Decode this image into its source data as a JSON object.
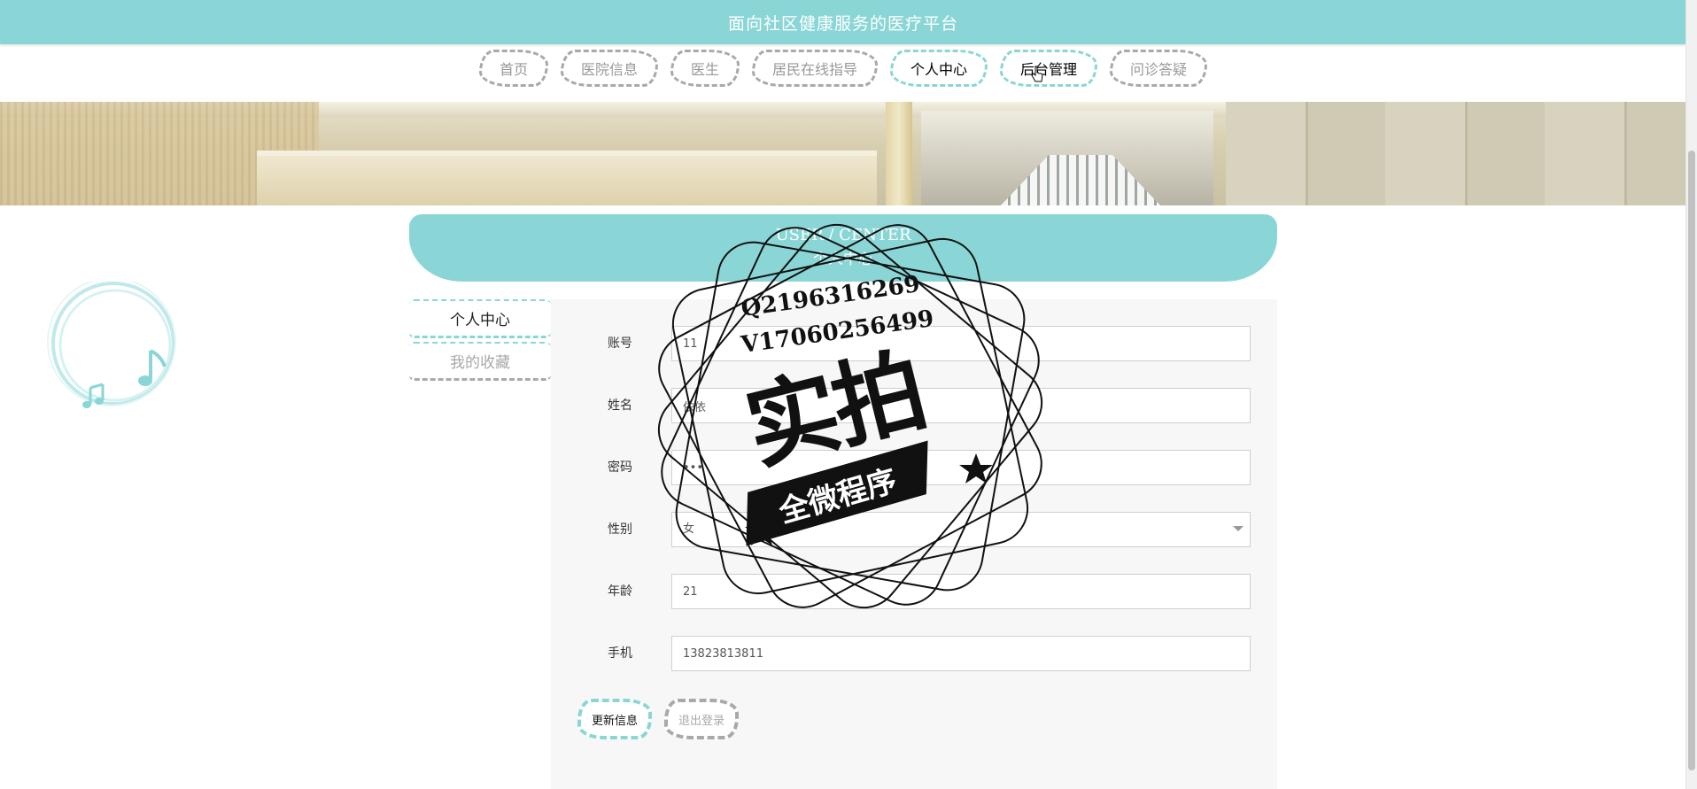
{
  "header": {
    "site_title": "面向社区健康服务的医疗平台"
  },
  "nav": {
    "items": [
      {
        "label": "首页",
        "active": false
      },
      {
        "label": "医院信息",
        "active": false
      },
      {
        "label": "医生",
        "active": false
      },
      {
        "label": "居民在线指导",
        "active": false
      },
      {
        "label": "个人中心",
        "active": true
      },
      {
        "label": "后台管理",
        "active": true
      },
      {
        "label": "问诊答疑",
        "active": false
      }
    ]
  },
  "section": {
    "title_en": "USER / CENTER",
    "title_cn": "个人中心"
  },
  "side_menu": {
    "items": [
      {
        "label": "个人中心",
        "active": true
      },
      {
        "label": "我的收藏",
        "active": false
      }
    ]
  },
  "form": {
    "account": {
      "label": "账号",
      "value": "11"
    },
    "name": {
      "label": "姓名",
      "value": "依依"
    },
    "password": {
      "label": "密码",
      "value": "•••"
    },
    "gender": {
      "label": "性别",
      "value": "女"
    },
    "age": {
      "label": "年龄",
      "value": "21"
    },
    "phone": {
      "label": "手机",
      "value": "13823813811"
    },
    "update_button": "更新信息",
    "logout_button": "退出登录"
  },
  "watermark": {
    "line1": "Q2196316269",
    "line2": "V17060256499",
    "big_text": "实拍",
    "ribbon_text": "全微程序"
  },
  "colors": {
    "accent": "#8ad6d6",
    "muted_border": "#a9a9a9"
  }
}
